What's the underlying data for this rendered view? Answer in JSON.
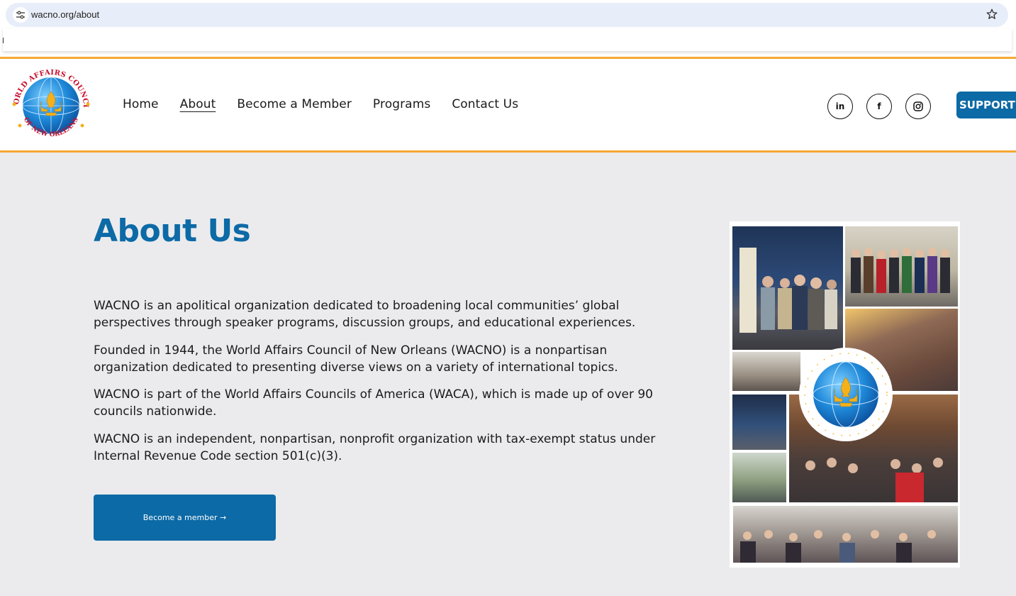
{
  "browser": {
    "url": "wacno.org/about"
  },
  "header": {
    "nav": [
      {
        "label": "Home",
        "active": false
      },
      {
        "label": "About",
        "active": true
      },
      {
        "label": "Become a Member",
        "active": false
      },
      {
        "label": "Programs",
        "active": false
      },
      {
        "label": "Contact Us",
        "active": false
      }
    ],
    "social": {
      "linkedin": "in",
      "facebook": "f"
    },
    "support_label": "SUPPORT C",
    "logo_text": {
      "top": "WORLD AFFAIRS COUNCIL",
      "bottom": "OF NEW ORLEANS"
    }
  },
  "main": {
    "title": "About Us",
    "paragraphs": [
      "WACNO is an apolitical organization dedicated to broadening local communities’ global perspectives through speaker programs, discussion groups, and educational experiences.",
      "Founded in 1944, the World Affairs Council of New Orleans (WACNO) is a nonpartisan organization dedicated to presenting diverse views on a variety of international topics.",
      "WACNO is part of the World Affairs Councils of America (WACA), which is made up of over 90 councils nationwide.",
      "WACNO is an independent, nonpartisan, nonprofit organization with tax-exempt status under Internal Revenue Code section 501(c)(3)."
    ],
    "cta_label": "Become a member →"
  },
  "colors": {
    "brand_blue": "#0c6aa6",
    "accent_orange": "#f7a833",
    "background": "#ebebed"
  }
}
